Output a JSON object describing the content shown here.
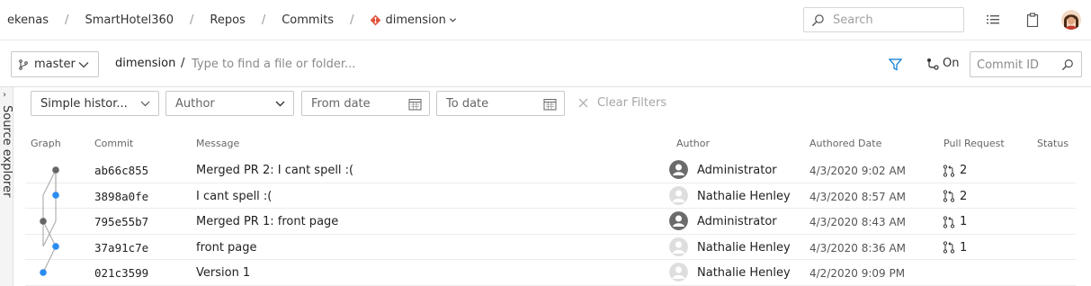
{
  "breadcrumb": {
    "items": [
      "ekenas",
      "SmartHotel360",
      "Repos",
      "Commits"
    ],
    "separator": "/",
    "repo": "dimension"
  },
  "header": {
    "search_placeholder": "Search",
    "icons": [
      "search-icon",
      "list-icon",
      "clipboard-icon",
      "user-avatar"
    ]
  },
  "toolbar": {
    "branch": "master",
    "path_root": "dimension",
    "path_separator": "/",
    "path_placeholder": "Type to find a file or folder...",
    "graph_toggle_label": "On",
    "commit_id_placeholder": "Commit ID"
  },
  "side_panel": {
    "arrow": "›",
    "label": "Source explorer"
  },
  "filters": {
    "history_mode": "Simple histor...",
    "author_placeholder": "Author",
    "from_date_placeholder": "From date",
    "to_date_placeholder": "To date",
    "clear_label": "Clear Filters"
  },
  "table": {
    "columns": [
      "Graph",
      "Commit",
      "Message",
      "Author",
      "Authored Date",
      "Pull Request",
      "Status"
    ],
    "rows": [
      {
        "commit": "ab66c855",
        "message": "Merged PR 2: I cant spell :(",
        "author": "Administrator",
        "avatar": "admin",
        "date": "4/3/2020 9:02 AM",
        "pr": "2"
      },
      {
        "commit": "3898a0fe",
        "message": "I cant spell :(",
        "author": "Nathalie Henley",
        "avatar": "user",
        "date": "4/3/2020 8:57 AM",
        "pr": "2"
      },
      {
        "commit": "795e55b7",
        "message": "Merged PR 1: front page",
        "author": "Administrator",
        "avatar": "admin",
        "date": "4/3/2020 8:43 AM",
        "pr": "1"
      },
      {
        "commit": "37a91c7e",
        "message": "front page",
        "author": "Nathalie Henley",
        "avatar": "user",
        "date": "4/3/2020 8:36 AM",
        "pr": "1"
      },
      {
        "commit": "021c3599",
        "message": "Version 1",
        "author": "Nathalie Henley",
        "avatar": "user",
        "date": "4/2/2020 9:09 PM",
        "pr": ""
      }
    ]
  },
  "colors": {
    "accent": "#0078d4",
    "repo_icon": "#e0533d",
    "graph_merge_node": "#666666",
    "graph_commit_node": "#2b8cf0"
  }
}
